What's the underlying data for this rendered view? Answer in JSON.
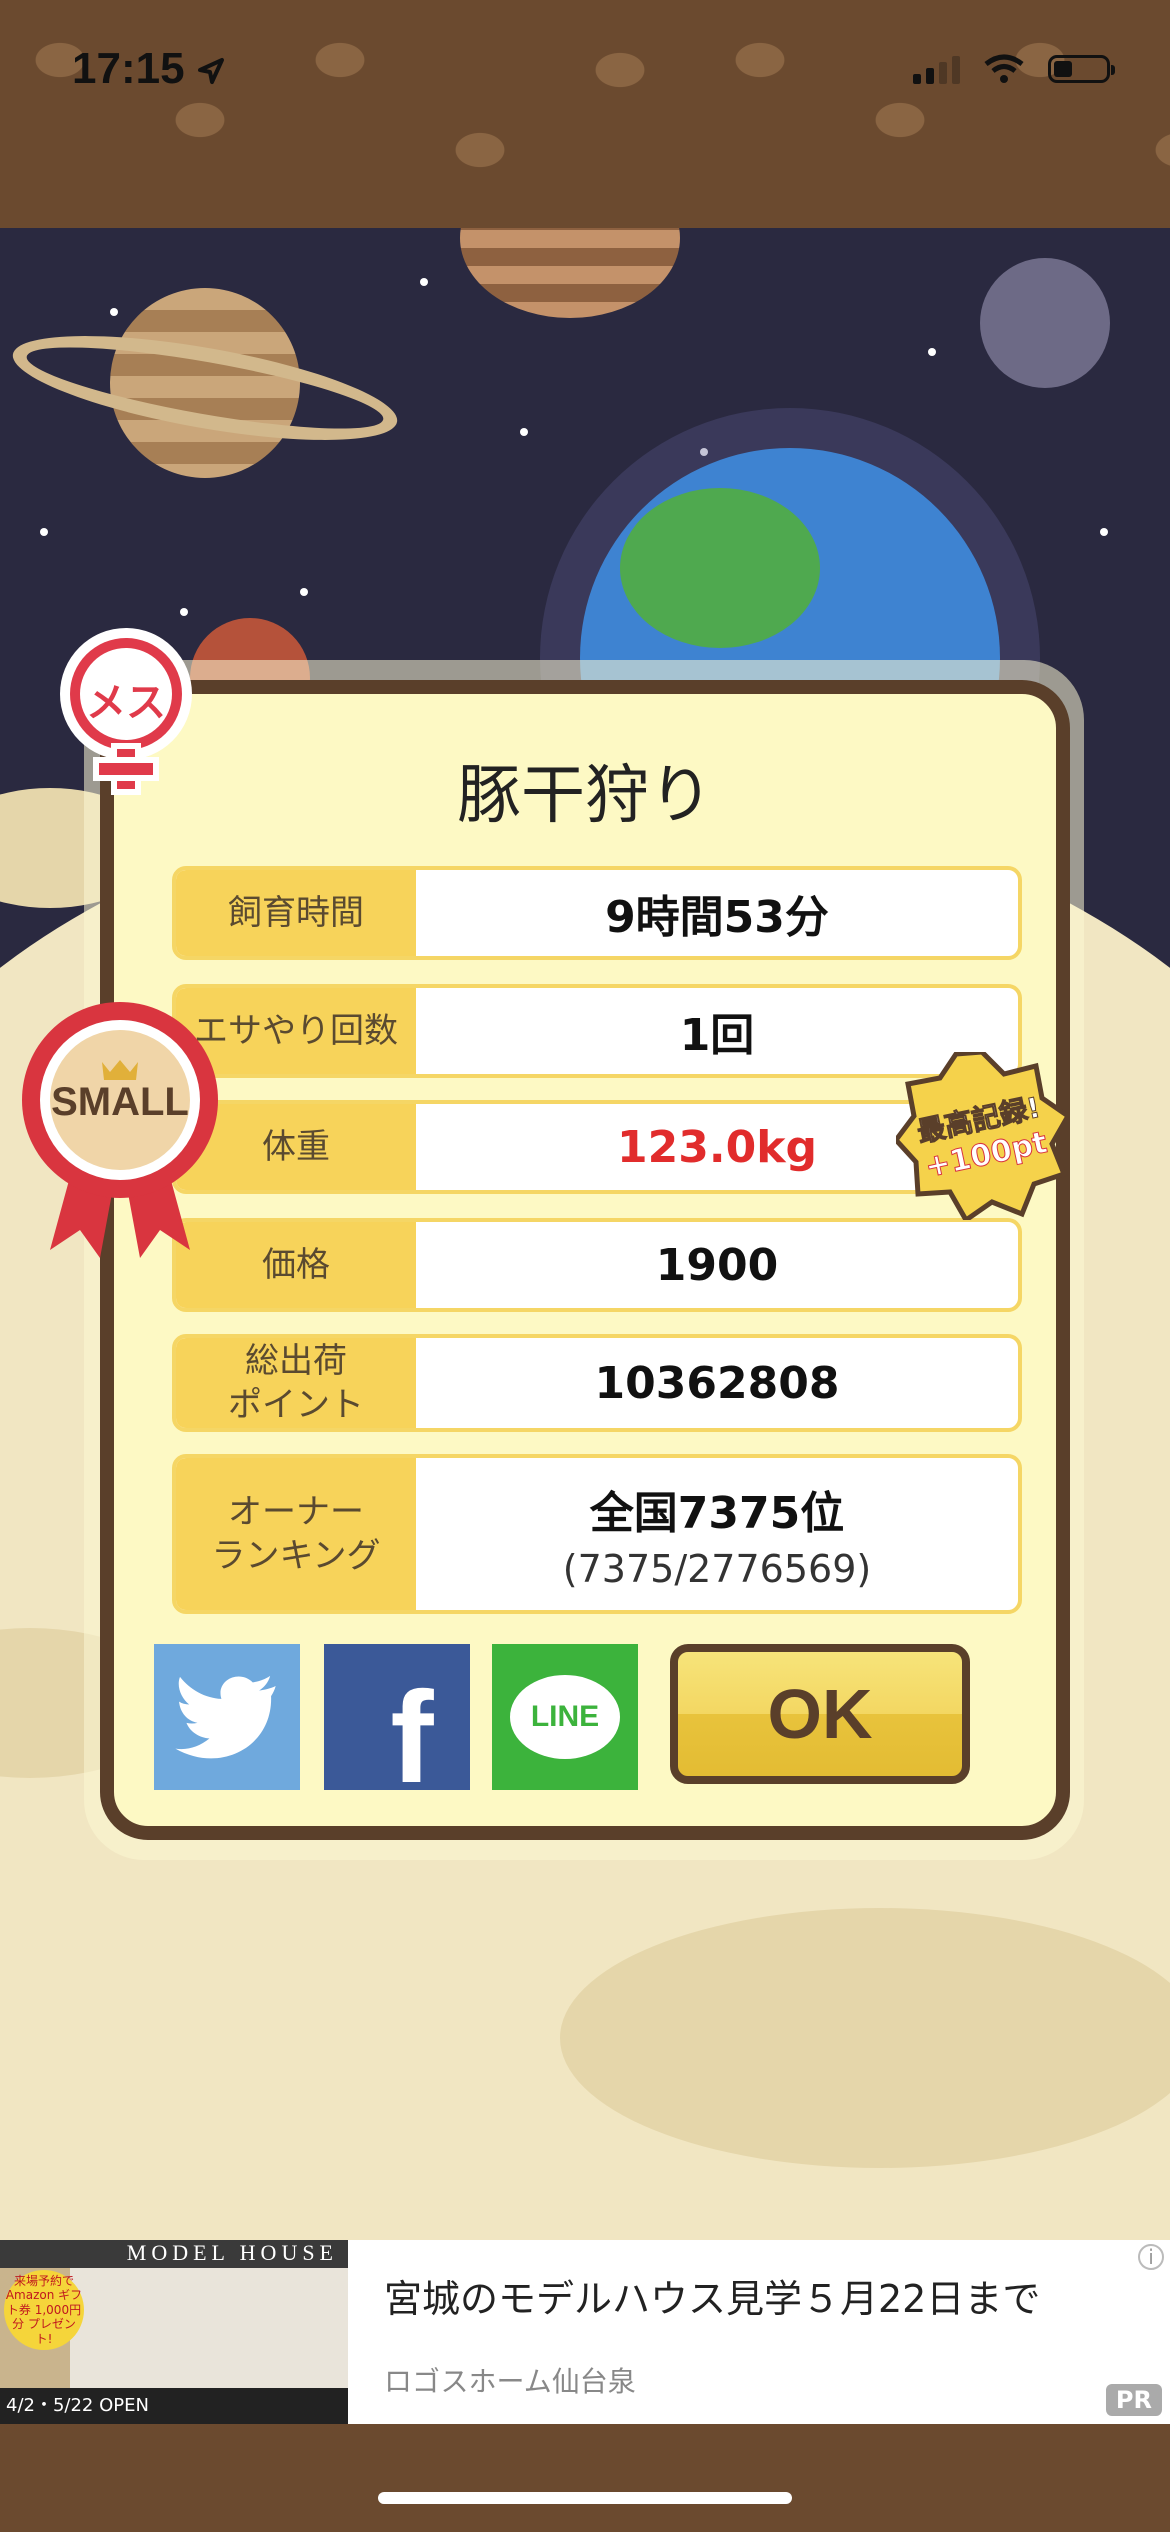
{
  "status_bar": {
    "time": "17:15"
  },
  "dialog": {
    "title": "豚干狩り",
    "rows": [
      {
        "label": "飼育時間",
        "value": "9時間53分"
      },
      {
        "label": "エサやり回数",
        "value": "1回"
      },
      {
        "label": "体重",
        "value": "123.0kg"
      },
      {
        "label": "価格",
        "value": "1900"
      },
      {
        "label": "総出荷\nポイント",
        "value": "10362808"
      },
      {
        "label": "オーナー\nランキング",
        "value": "全国7375位",
        "sub": "(7375/2776569)"
      }
    ],
    "ok_label": "OK",
    "social": {
      "twitter": "twitter-icon",
      "facebook": "f",
      "line": "LINE"
    }
  },
  "badges": {
    "female": "メス",
    "size": "SMALL",
    "record_line1": "最高記録!",
    "record_line2": "+100pt"
  },
  "ad": {
    "thumb_title": "MODEL HOUSE",
    "thumb_gift": "来場予約で Amazon ギフト券 1,000円分 プレゼント!",
    "thumb_footer": "4/2・5/22 OPEN",
    "headline": "宮城のモデルハウス見学５月22日まで",
    "source": "ロゴスホーム仙台泉",
    "pr": "PR"
  },
  "colors": {
    "frame_brown": "#5a3f2a",
    "label_yellow": "#f7d35a",
    "weight_red": "#e12c2c",
    "twitter": "#6fa9dd",
    "facebook": "#3b5998",
    "line": "#3cb33c"
  }
}
